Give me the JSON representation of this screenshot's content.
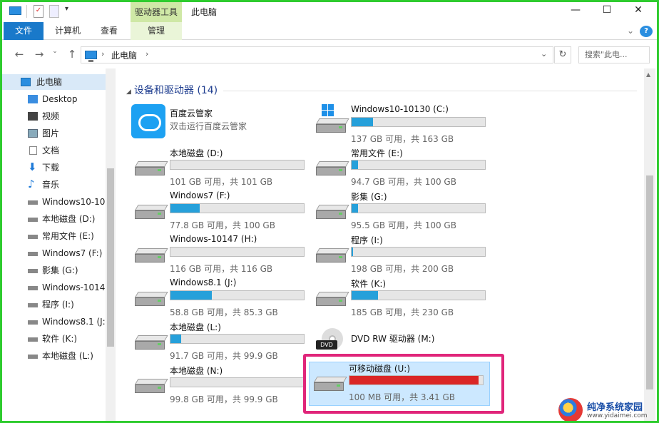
{
  "window": {
    "title": "此电脑",
    "context_tab": "驱动器工具"
  },
  "ribbon": {
    "tabs": [
      "文件",
      "计算机",
      "查看",
      "管理"
    ]
  },
  "address": {
    "crumb": "此电脑",
    "search_placeholder": "搜索\"此电..."
  },
  "nav": {
    "items": [
      "此电脑",
      "Desktop",
      "视频",
      "图片",
      "文档",
      "下载",
      "音乐",
      "Windows10-10",
      "本地磁盘 (D:)",
      "常用文件 (E:)",
      "Windows7 (F:)",
      "影集 (G:)",
      "Windows-1014",
      "程序 (I:)",
      "Windows8.1 (J:",
      "软件 (K:)",
      "本地磁盘 (L:)"
    ]
  },
  "group": {
    "title": "设备和驱动器 (14)"
  },
  "drives": [
    {
      "name": "百度云管家",
      "free": "双击运行百度云管家",
      "used_frac": null,
      "icon": "baidu-cloud-icon"
    },
    {
      "name": "Windows10-10130 (C:)",
      "free": "137 GB 可用，共 163 GB",
      "used_frac": 0.16,
      "icon": "windows-drive-icon"
    },
    {
      "name": "本地磁盘 (D:)",
      "free": "101 GB 可用，共 101 GB",
      "used_frac": 0.0,
      "icon": "hard-drive-icon"
    },
    {
      "name": "常用文件 (E:)",
      "free": "94.7 GB 可用，共 100 GB",
      "used_frac": 0.05,
      "icon": "hard-drive-icon"
    },
    {
      "name": "Windows7 (F:)",
      "free": "77.8 GB 可用，共 100 GB",
      "used_frac": 0.22,
      "icon": "hard-drive-icon"
    },
    {
      "name": "影集 (G:)",
      "free": "95.5 GB 可用，共 100 GB",
      "used_frac": 0.05,
      "icon": "hard-drive-icon"
    },
    {
      "name": "Windows-10147 (H:)",
      "free": "116 GB 可用，共 116 GB",
      "used_frac": 0.0,
      "icon": "hard-drive-icon"
    },
    {
      "name": "程序 (I:)",
      "free": "198 GB 可用，共 200 GB",
      "used_frac": 0.01,
      "icon": "hard-drive-icon"
    },
    {
      "name": "Windows8.1 (J:)",
      "free": "58.8 GB 可用，共 85.3 GB",
      "used_frac": 0.31,
      "icon": "hard-drive-icon"
    },
    {
      "name": "软件 (K:)",
      "free": "185 GB 可用，共 230 GB",
      "used_frac": 0.2,
      "icon": "hard-drive-icon"
    },
    {
      "name": "本地磁盘 (L:)",
      "free": "91.7 GB 可用，共 99.9 GB",
      "used_frac": 0.08,
      "icon": "hard-drive-icon"
    },
    {
      "name": "DVD RW 驱动器 (M:)",
      "free": "",
      "used_frac": null,
      "icon": "dvd-drive-icon"
    },
    {
      "name": "本地磁盘 (N:)",
      "free": "99.8 GB 可用，共 99.9 GB",
      "used_frac": 0.0,
      "icon": "hard-drive-icon"
    },
    {
      "name": "可移动磁盘 (U:)",
      "free": "100 MB 可用，共 3.41 GB",
      "used_frac": 0.97,
      "icon": "removable-drive-icon"
    }
  ],
  "colors": {
    "accent": "#1979ca",
    "bar_normal": "#26a0da",
    "bar_full": "#da2626",
    "highlight_frame": "#e0257a",
    "context_tab": "#cfe8a6"
  },
  "watermark": {
    "text": "纯净系统家园",
    "url": "www.yidaimei.com"
  }
}
